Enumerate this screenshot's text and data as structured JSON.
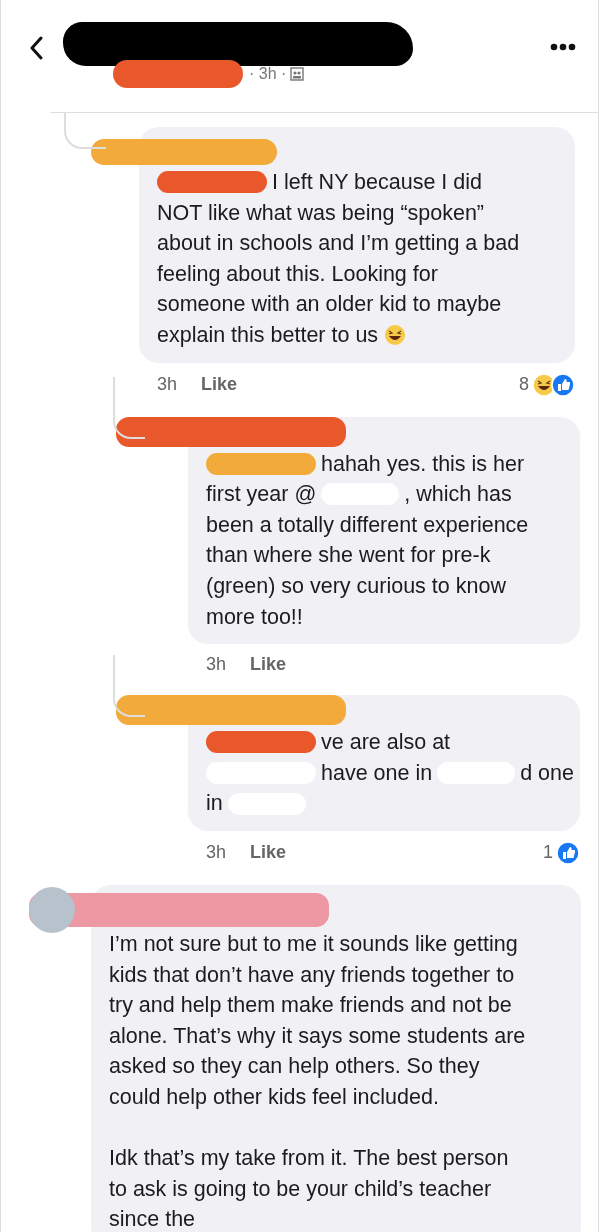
{
  "header": {
    "time": "· 3h ·"
  },
  "comments": [
    {
      "kind": "reply",
      "name_mark": {
        "color": "#f2ab3a"
      },
      "paragraphs": [
        [
          [
            {
              "kind": "redaction",
              "color": "#e8582a"
            },
            {
              "kind": "text",
              "text": "I left NY because I did"
            }
          ],
          [
            {
              "kind": "text",
              "text": "NOT like what was being “spoken”"
            }
          ],
          [
            {
              "kind": "text",
              "text": "about in schools and I’m getting a bad"
            }
          ],
          [
            {
              "kind": "text",
              "text": "feeling about this. Looking for"
            }
          ],
          [
            {
              "kind": "text",
              "text": "someone with an older kid to maybe"
            }
          ],
          [
            {
              "kind": "text",
              "text": "explain this better to us"
            },
            {
              "kind": "emoji"
            }
          ]
        ]
      ],
      "time": "3h",
      "like": "Like",
      "reactions": {
        "count": "8",
        "icons": [
          {
            "kind": "haha"
          },
          {
            "kind": "like"
          }
        ]
      },
      "children": [
        {
          "kind": "reply",
          "name_mark": {
            "color": "#e8582a"
          },
          "paragraphs": [
            [
              [
                {
                  "kind": "redaction",
                  "color": "#f2ab3a"
                },
                {
                  "kind": "text",
                  "text": "hahah yes. this is her"
                }
              ],
              [
                {
                  "kind": "text",
                  "text": "first year @"
                },
                {
                  "kind": "redaction",
                  "color": "#ffffff"
                },
                {
                  "kind": "text",
                  "text": ", which has"
                }
              ],
              [
                {
                  "kind": "text",
                  "text": "been a totally different experience"
                }
              ],
              [
                {
                  "kind": "text",
                  "text": "than where she went for pre-k"
                }
              ],
              [
                {
                  "kind": "text",
                  "text": "(green) so very curious to know"
                }
              ],
              [
                {
                  "kind": "text",
                  "text": "more too!!"
                }
              ]
            ]
          ],
          "time": "3h",
          "like": "Like"
        },
        {
          "kind": "reply",
          "name_mark": {
            "color": "#f2ab3a"
          },
          "paragraphs": [
            [
              [
                {
                  "kind": "redaction",
                  "color": "#e8582a"
                },
                {
                  "kind": "text",
                  "text": "ve are also at"
                }
              ],
              [
                {
                  "kind": "redaction",
                  "color": "#ffffff"
                },
                {
                  "kind": "text",
                  "text": "have one in"
                },
                {
                  "kind": "redaction",
                  "color": "#ffffff"
                },
                {
                  "kind": "text",
                  "text": "d one"
                }
              ],
              [
                {
                  "kind": "text",
                  "text": "in"
                },
                {
                  "kind": "redaction",
                  "color": "#ffffff"
                }
              ]
            ]
          ],
          "time": "3h",
          "like": "Like",
          "reactions": {
            "count": "1",
            "icons": [
              {
                "kind": "like"
              }
            ]
          }
        }
      ]
    },
    {
      "kind": "comment",
      "name_mark": {
        "color": "#ee98a3"
      },
      "paragraphs": [
        [
          [
            {
              "kind": "text",
              "text": "I’m not sure but to me it sounds like getting"
            }
          ],
          [
            {
              "kind": "text",
              "text": "kids that don’t have any friends together to"
            }
          ],
          [
            {
              "kind": "text",
              "text": "try and help them make friends and not be"
            }
          ],
          [
            {
              "kind": "text",
              "text": "alone. That’s why it says some students are"
            }
          ],
          [
            {
              "kind": "text",
              "text": "asked so they can help others. So they"
            }
          ],
          [
            {
              "kind": "text",
              "text": "could help other kids feel included."
            }
          ]
        ],
        [
          [
            {
              "kind": "text",
              "text": "Idk that’s my take from it. The best person"
            }
          ],
          [
            {
              "kind": "text",
              "text": "to ask is going to be your child’s teacher"
            }
          ],
          [
            {
              "kind": "text",
              "text": "since the"
            }
          ]
        ]
      ]
    }
  ]
}
